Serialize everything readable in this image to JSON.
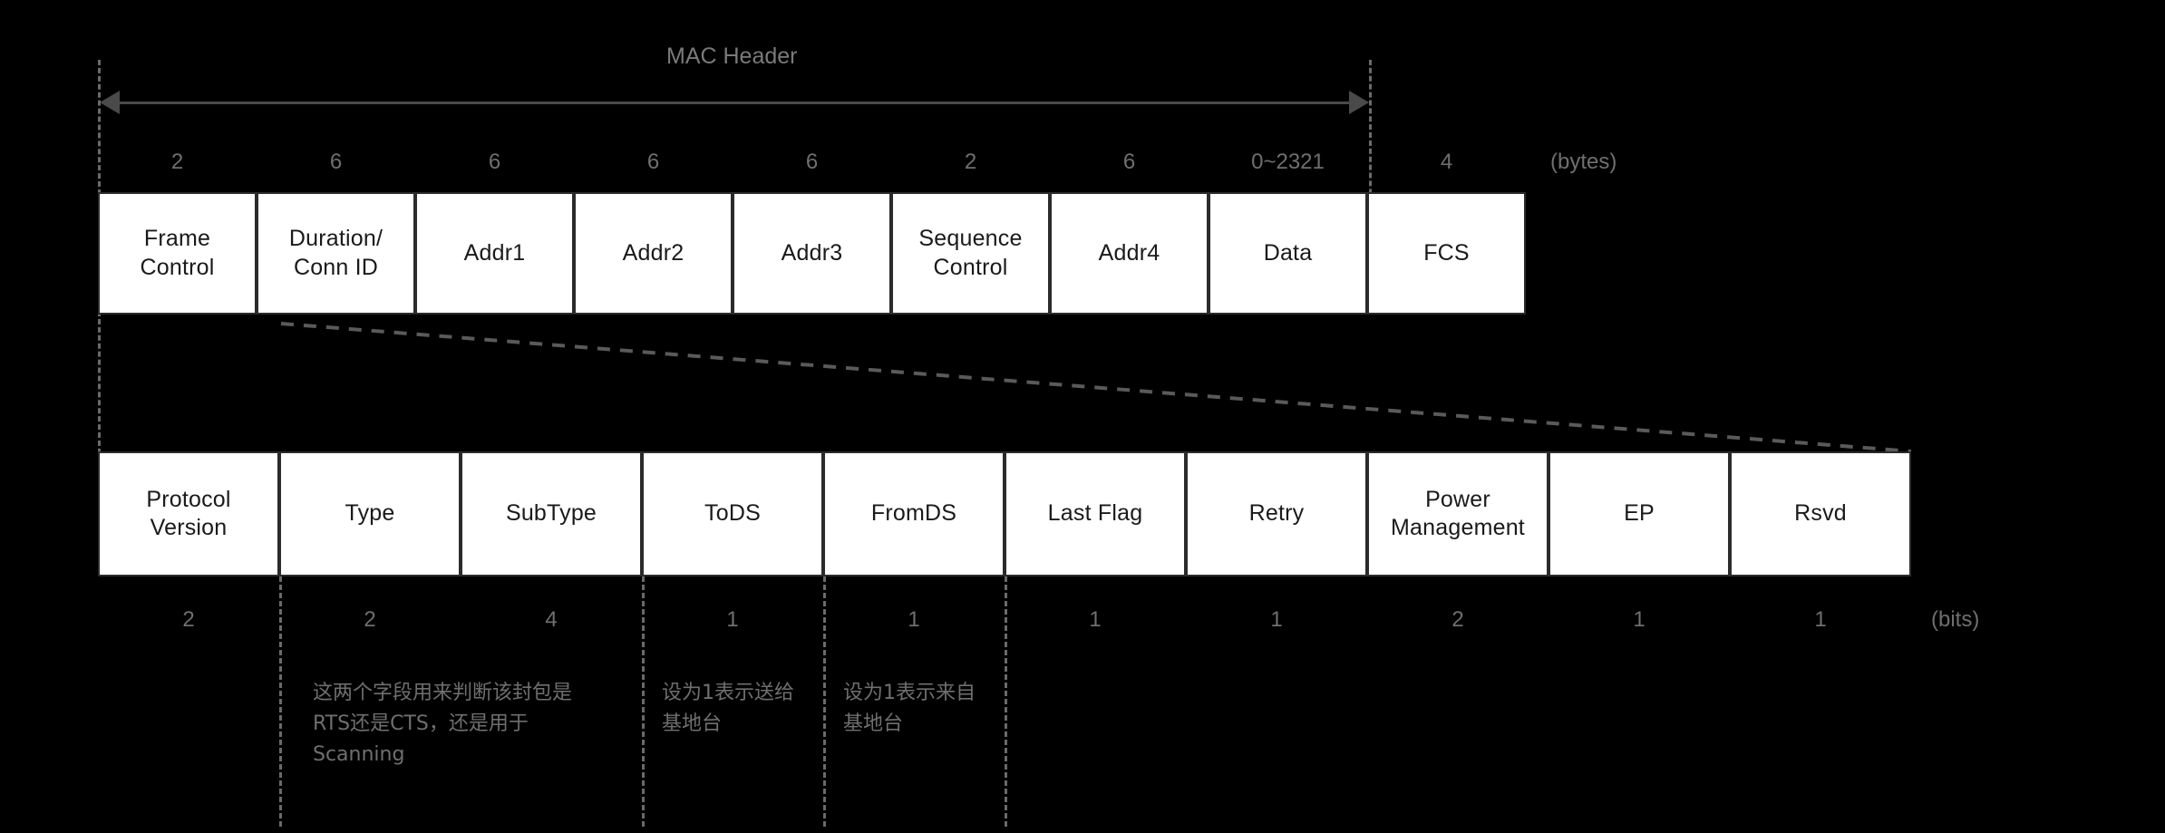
{
  "diagram": {
    "title_label": "MAC Header",
    "byte_unit_label": "(bytes)",
    "bit_unit_label": "(bits)",
    "accent_box_fill": "#ffffff",
    "accent_box_border": "#2b2b2b",
    "background": "#000000",
    "label_color": "#6f6f6f"
  },
  "mac_frame": {
    "unit": "(bytes)",
    "fields": [
      {
        "name": "Frame Control",
        "line1": "Frame",
        "line2": "Control",
        "size": "2"
      },
      {
        "name": "Duration/Conn ID",
        "line1": "Duration/",
        "line2": "Conn ID",
        "size": "6"
      },
      {
        "name": "Addr1",
        "line1": "Addr1",
        "line2": "",
        "size": "6"
      },
      {
        "name": "Addr2",
        "line1": "Addr2",
        "line2": "",
        "size": "6"
      },
      {
        "name": "Addr3",
        "line1": "Addr3",
        "line2": "",
        "size": "6"
      },
      {
        "name": "Sequence Control",
        "line1": "Sequence",
        "line2": "Control",
        "size": "2"
      },
      {
        "name": "Addr4",
        "line1": "Addr4",
        "line2": "",
        "size": "6"
      },
      {
        "name": "Data",
        "line1": "Data",
        "line2": "",
        "size": "0~2321"
      },
      {
        "name": "FCS",
        "line1": "FCS",
        "line2": "",
        "size": "4"
      }
    ]
  },
  "frame_control": {
    "unit": "(bits)",
    "fields": [
      {
        "name": "Protocol Version",
        "line1": "Protocol",
        "line2": "Version",
        "size": "2"
      },
      {
        "name": "Type",
        "line1": "Type",
        "line2": "",
        "size": "2"
      },
      {
        "name": "SubType",
        "line1": "SubType",
        "line2": "",
        "size": "4"
      },
      {
        "name": "ToDS",
        "line1": "ToDS",
        "line2": "",
        "size": "1"
      },
      {
        "name": "FromDS",
        "line1": "FromDS",
        "line2": "",
        "size": "1"
      },
      {
        "name": "Last Flag",
        "line1": "Last Flag",
        "line2": "",
        "size": "1"
      },
      {
        "name": "Retry",
        "line1": "Retry",
        "line2": "",
        "size": "1"
      },
      {
        "name": "Power Management",
        "line1": "Power",
        "line2": "Management",
        "size": "2"
      },
      {
        "name": "EP",
        "line1": "EP",
        "line2": "",
        "size": "1"
      },
      {
        "name": "Rsvd",
        "line1": "Rsvd",
        "line2": "",
        "size": "1"
      }
    ]
  },
  "annotations": [
    {
      "id": "type-subtype-note",
      "text": "这两个字段用来判断该封包是RTS还是CTS，还是用于Scanning"
    },
    {
      "id": "tods-note",
      "text": "设为1表示送给基地台"
    },
    {
      "id": "fromds-note",
      "text": "设为1表示来自基地台"
    }
  ]
}
